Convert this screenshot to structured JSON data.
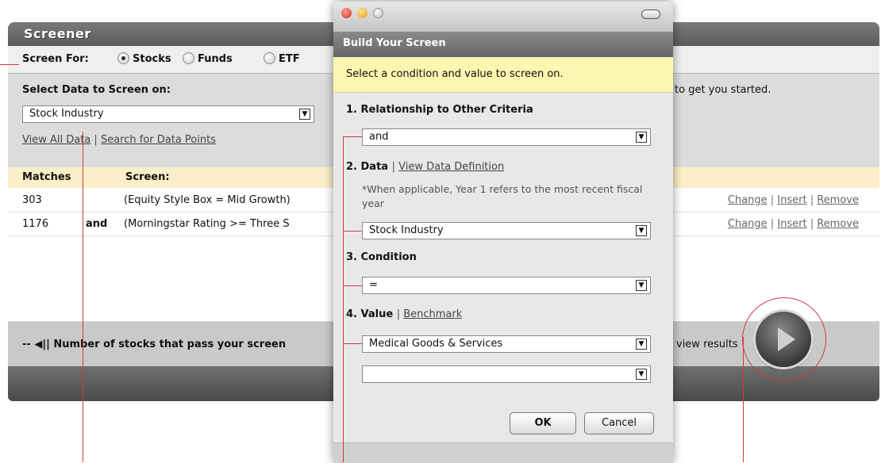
{
  "screener": {
    "title": "Screener",
    "screen_for_label": "Screen For:",
    "options": [
      "Stocks",
      "Funds",
      "ETF"
    ],
    "select_data_label": "Select Data to Screen on:",
    "data_dropdown_value": "Stock Industry",
    "view_all_link": "View All Data",
    "separator": "|",
    "search_link": "Search for Data Points",
    "started_text": "to get you started.",
    "col_matches": "Matches",
    "col_screen": "Screen:",
    "rows": [
      {
        "matches": "303",
        "connector": "",
        "screen": "(Equity Style Box = Mid Growth)"
      },
      {
        "matches": "1176",
        "connector": "and",
        "screen": "(Morningstar Rating >= Three S"
      }
    ],
    "row_actions": [
      "Change",
      "Insert",
      "Remove"
    ],
    "bottom_text": "-- ◀|| Number of stocks that pass your screen",
    "view_results": "view results"
  },
  "dialog": {
    "header": "Build Your Screen",
    "info": "Select a condition and value to screen on.",
    "step1_label": "1. Relationship to Other Criteria",
    "step1_value": "and",
    "step2_label": "2. Data",
    "step2_link": "View Data Definition",
    "step2_note": "*When applicable, Year 1 refers to the most recent fiscal year",
    "step2_value": "Stock Industry",
    "step3_label": "3. Condition",
    "step3_value": "=",
    "step4_label": "4. Value",
    "step4_link": "Benchmark",
    "step4_value": "Medical Goods & Services",
    "step4_value2": "",
    "ok_label": "OK",
    "cancel_label": "Cancel"
  },
  "colors": {
    "accent_line": "#d23a3a",
    "info_bg": "#fbf6b0",
    "table_header_bg": "#fbeec8"
  }
}
